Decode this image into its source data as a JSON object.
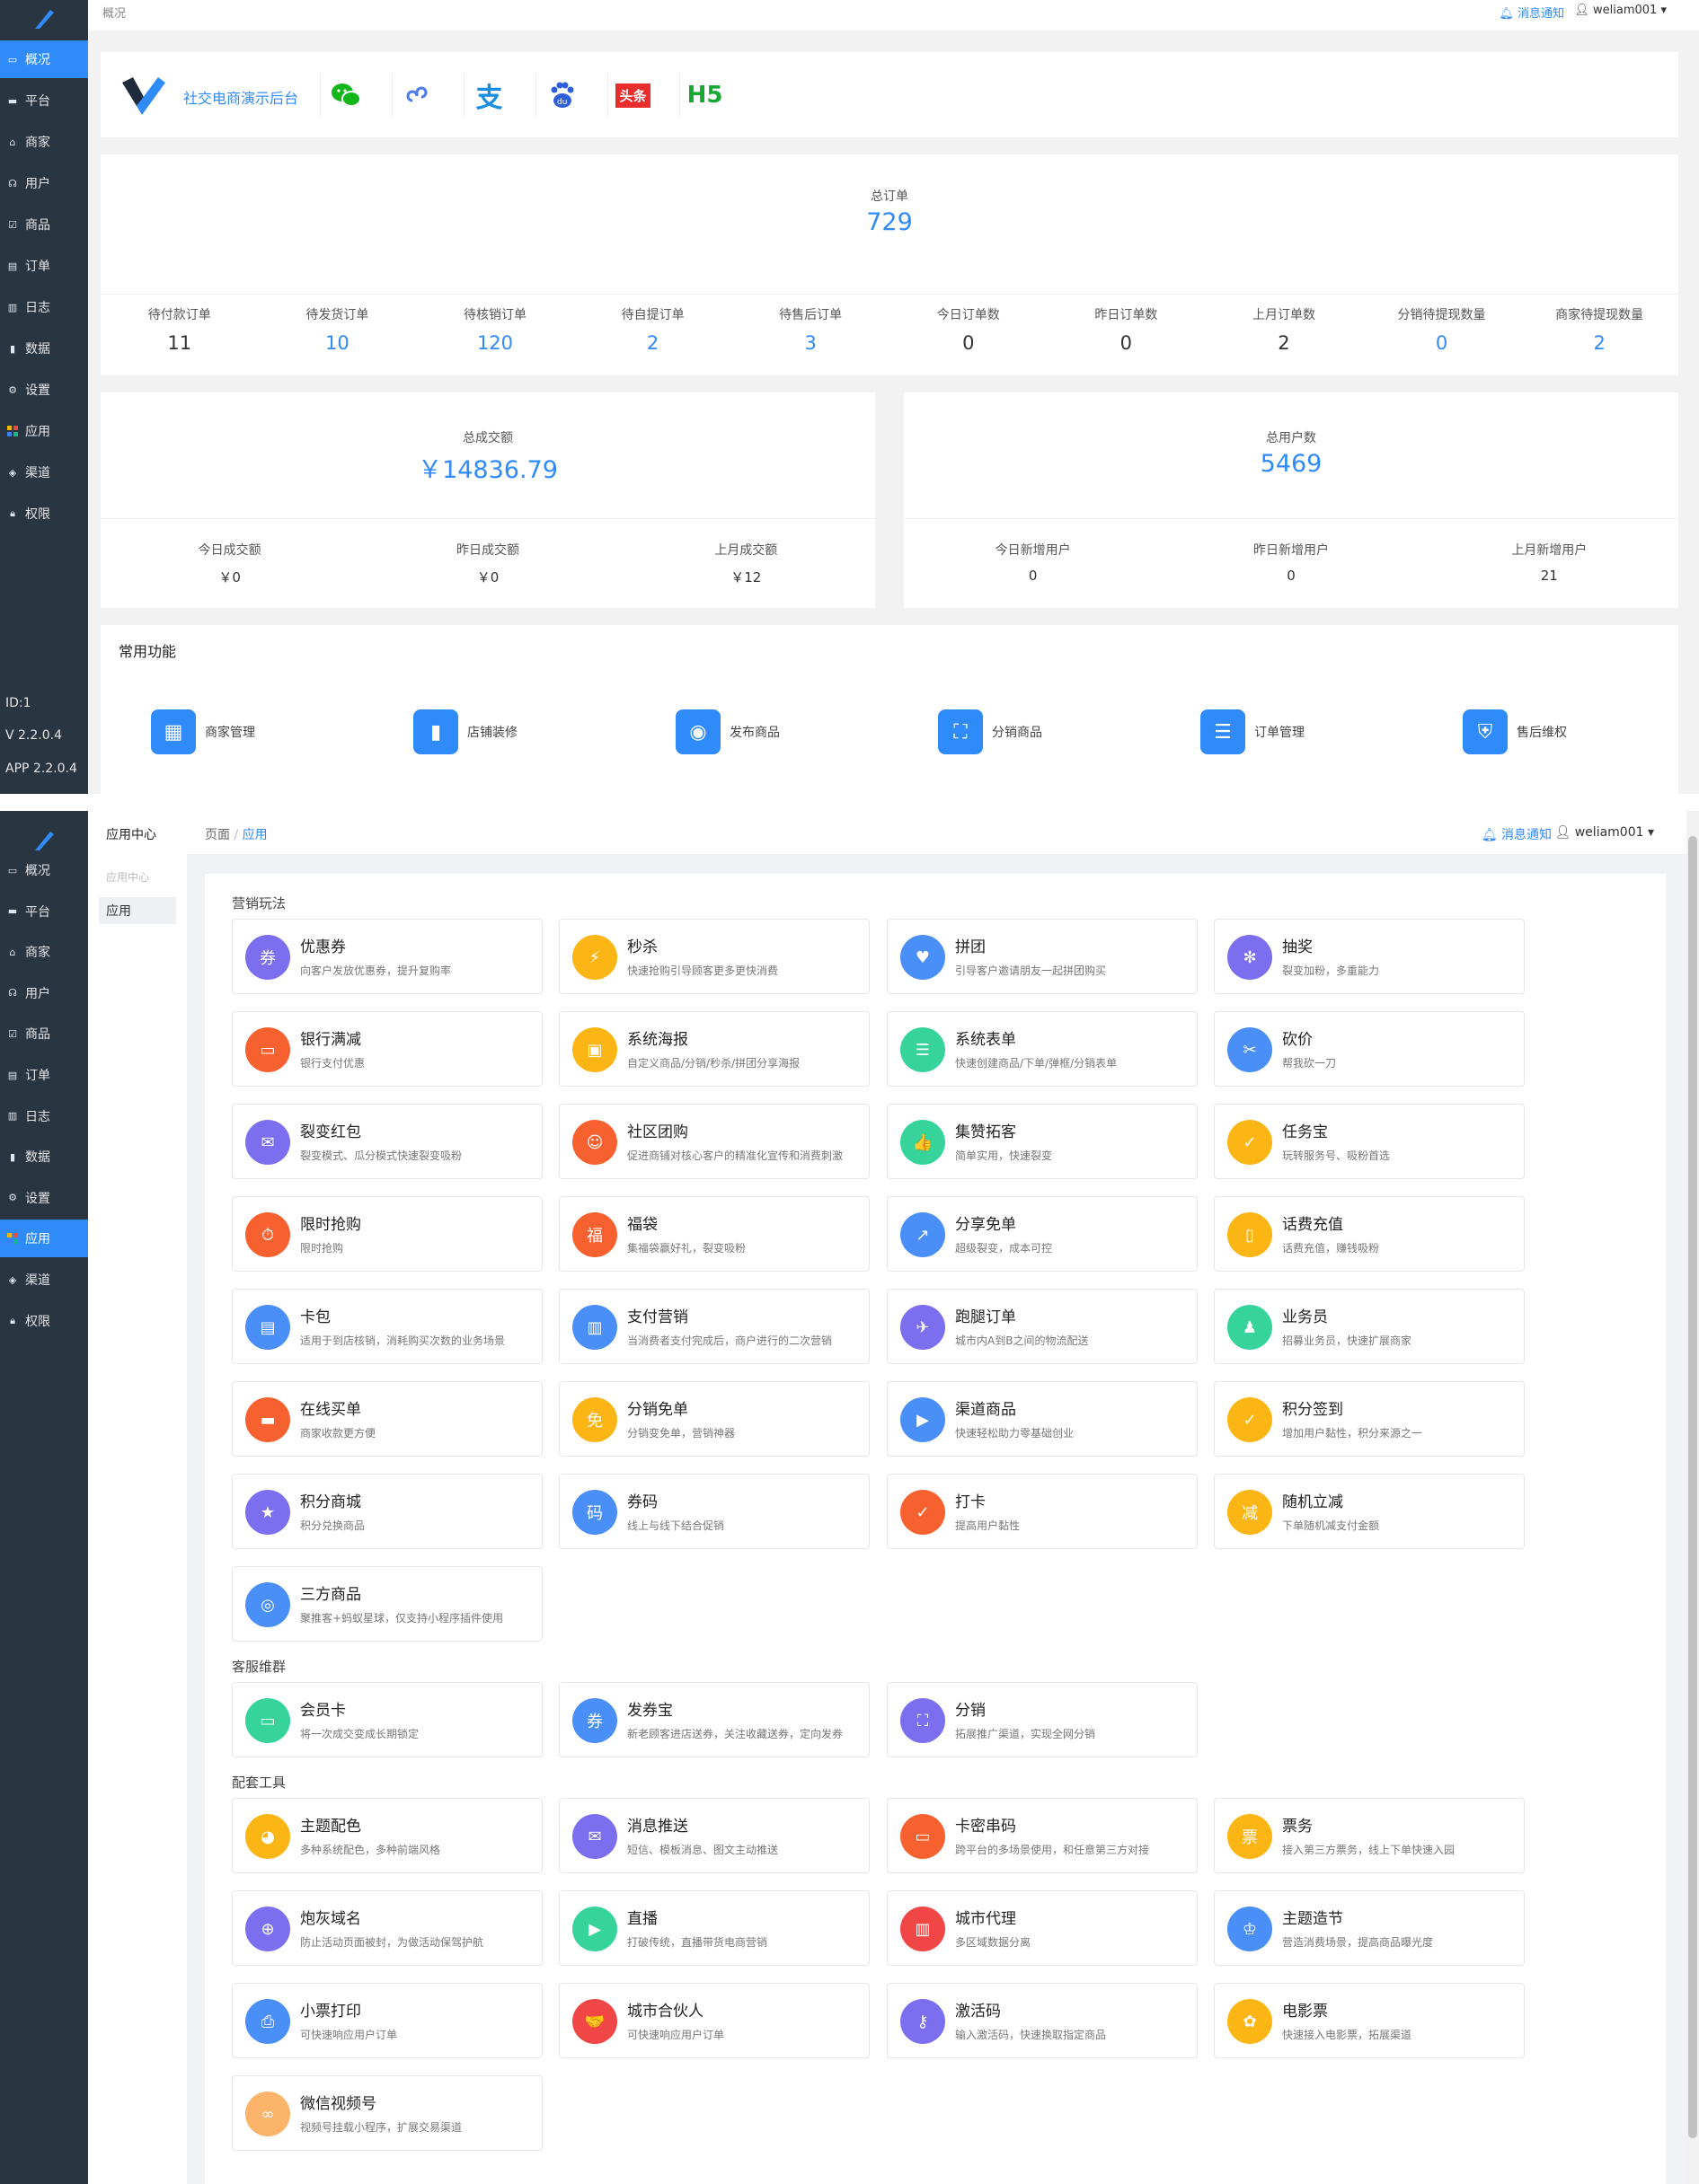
{
  "overview": {
    "breadcrumb": "概况",
    "notice": "消息通知",
    "user": "weliam001",
    "nav": [
      {
        "label": "概况",
        "icon": "monitor-icon"
      },
      {
        "label": "平台",
        "icon": "platform-icon"
      },
      {
        "label": "商家",
        "icon": "store-icon"
      },
      {
        "label": "用户",
        "icon": "headset-icon"
      },
      {
        "label": "商品",
        "icon": "goods-icon"
      },
      {
        "label": "订单",
        "icon": "order-icon"
      },
      {
        "label": "日志",
        "icon": "log-icon"
      },
      {
        "label": "数据",
        "icon": "chart-icon"
      },
      {
        "label": "设置",
        "icon": "gear-icon"
      },
      {
        "label": "应用",
        "icon": "apps-icon"
      },
      {
        "label": "渠道",
        "icon": "channel-icon"
      },
      {
        "label": "权限",
        "icon": "lock-icon"
      }
    ],
    "footer": {
      "id": "ID:1",
      "version": "V 2.2.0.4",
      "app_version": "APP 2.2.0.4"
    },
    "brand": {
      "name": "社交电商演示后台",
      "platforms": [
        "wechat-icon",
        "mini-program-icon",
        "alipay-icon",
        "baidu-icon",
        "toutiao-icon",
        "H5"
      ],
      "toutiao_label": "头条",
      "h5_label": "H5"
    },
    "orders": {
      "total_label": "总订单",
      "total": "729",
      "items": [
        {
          "label": "待付款订单",
          "value": "11",
          "color": "#333"
        },
        {
          "label": "待发货订单",
          "value": "10",
          "color": "#2f8bfa"
        },
        {
          "label": "待核销订单",
          "value": "120",
          "color": "#2f8bfa"
        },
        {
          "label": "待自提订单",
          "value": "2",
          "color": "#2f8bfa"
        },
        {
          "label": "待售后订单",
          "value": "3",
          "color": "#2f8bfa"
        },
        {
          "label": "今日订单数",
          "value": "0",
          "color": "#333"
        },
        {
          "label": "昨日订单数",
          "value": "0",
          "color": "#333"
        },
        {
          "label": "上月订单数",
          "value": "2",
          "color": "#333"
        },
        {
          "label": "分销待提现数量",
          "value": "0",
          "color": "#2f8bfa"
        },
        {
          "label": "商家待提现数量",
          "value": "2",
          "color": "#2f8bfa"
        }
      ]
    },
    "sales": {
      "label": "总成交额",
      "value": "￥14836.79",
      "items": [
        {
          "label": "今日成交额",
          "value": "￥0"
        },
        {
          "label": "昨日成交额",
          "value": "￥0"
        },
        {
          "label": "上月成交额",
          "value": "￥12"
        }
      ]
    },
    "users": {
      "label": "总用户数",
      "value": "5469",
      "items": [
        {
          "label": "今日新增用户",
          "value": "0"
        },
        {
          "label": "昨日新增用户",
          "value": "0"
        },
        {
          "label": "上月新增用户",
          "value": "21"
        }
      ]
    },
    "common": {
      "title": "常用功能",
      "items": [
        "商家管理",
        "店铺装修",
        "发布商品",
        "分销商品",
        "订单管理",
        "售后维权"
      ]
    }
  },
  "apps_page": {
    "sub_title": "应用中心",
    "sub_group": "应用中心",
    "sub_item": "应用",
    "breadcrumb": [
      "页面",
      "应用"
    ],
    "breadcrumb_sep": "/",
    "notice": "消息通知",
    "user": "weliam001",
    "sections": [
      {
        "title": "营销玩法",
        "apps": [
          {
            "name": "优惠券",
            "desc": "向客户发放优惠券，提升复购率",
            "color": "#7b6ff0",
            "glyph": "券"
          },
          {
            "name": "秒杀",
            "desc": "快速抢购引导顾客更多更快消费",
            "color": "#fbb615",
            "glyph": "⚡"
          },
          {
            "name": "拼团",
            "desc": "引导客户邀请朋友一起拼团购买",
            "color": "#4a8ff7",
            "glyph": "♥"
          },
          {
            "name": "抽奖",
            "desc": "裂变加粉，多重能力",
            "color": "#7b6ff0",
            "glyph": "✻"
          },
          {
            "name": "银行满减",
            "desc": "银行支付优惠",
            "color": "#f7612f",
            "glyph": "▭"
          },
          {
            "name": "系统海报",
            "desc": "自定义商品/分销/秒杀/拼团分享海报",
            "color": "#fbb615",
            "glyph": "▣"
          },
          {
            "name": "系统表单",
            "desc": "快速创建商品/下单/弹框/分销表单",
            "color": "#36d49b",
            "glyph": "☰"
          },
          {
            "name": "砍价",
            "desc": "帮我砍一刀",
            "color": "#4a8ff7",
            "glyph": "✂"
          },
          {
            "name": "裂变红包",
            "desc": "裂变模式、瓜分模式快速裂变吸粉",
            "color": "#7b6ff0",
            "glyph": "✉"
          },
          {
            "name": "社区团购",
            "desc": "促进商铺对核心客户的精准化宣传和消费刺激",
            "color": "#f7612f",
            "glyph": "☺"
          },
          {
            "name": "集赞拓客",
            "desc": "简单实用，快速裂变",
            "color": "#36d49b",
            "glyph": "👍"
          },
          {
            "name": "任务宝",
            "desc": "玩转服务号、吸粉首选",
            "color": "#fbb615",
            "glyph": "✓"
          },
          {
            "name": "限时抢购",
            "desc": "限时抢购",
            "color": "#f7612f",
            "glyph": "⏱"
          },
          {
            "name": "福袋",
            "desc": "集福袋赢好礼，裂变吸粉",
            "color": "#f7612f",
            "glyph": "福"
          },
          {
            "name": "分享免单",
            "desc": "超级裂变，成本可控",
            "color": "#4a8ff7",
            "glyph": "↗"
          },
          {
            "name": "话费充值",
            "desc": "话费充值，赚钱吸粉",
            "color": "#fbb615",
            "glyph": "▯"
          },
          {
            "name": "卡包",
            "desc": "适用于到店核销，消耗购买次数的业务场景",
            "color": "#4a8ff7",
            "glyph": "▤"
          },
          {
            "name": "支付营销",
            "desc": "当消费者支付完成后，商户进行的二次营销",
            "color": "#4a8ff7",
            "glyph": "▥"
          },
          {
            "name": "跑腿订单",
            "desc": "城市内A到B之间的物流配送",
            "color": "#7b6ff0",
            "glyph": "✈"
          },
          {
            "name": "业务员",
            "desc": "招募业务员，快速扩展商家",
            "color": "#36d49b",
            "glyph": "♟"
          },
          {
            "name": "在线买单",
            "desc": "商家收款更方便",
            "color": "#f7612f",
            "glyph": "▬"
          },
          {
            "name": "分销免单",
            "desc": "分销变免单，营销神器",
            "color": "#fbb615",
            "glyph": "免"
          },
          {
            "name": "渠道商品",
            "desc": "快速轻松助力零基础创业",
            "color": "#4a8ff7",
            "glyph": "▶"
          },
          {
            "name": "积分签到",
            "desc": "增加用户黏性，积分来源之一",
            "color": "#fbb615",
            "glyph": "✓"
          },
          {
            "name": "积分商城",
            "desc": "积分兑换商品",
            "color": "#7b6ff0",
            "glyph": "★"
          },
          {
            "name": "券码",
            "desc": "线上与线下结合促销",
            "color": "#4a8ff7",
            "glyph": "码"
          },
          {
            "name": "打卡",
            "desc": "提高用户黏性",
            "color": "#f7612f",
            "glyph": "✓"
          },
          {
            "name": "随机立减",
            "desc": "下单随机减支付金额",
            "color": "#fbb615",
            "glyph": "减"
          },
          {
            "name": "三方商品",
            "desc": "聚推客+蚂蚁星球，仅支持小程序插件使用",
            "color": "#4a8ff7",
            "glyph": "◎"
          }
        ]
      },
      {
        "title": "客服维群",
        "apps": [
          {
            "name": "会员卡",
            "desc": "将一次成交变成长期锁定",
            "color": "#36d49b",
            "glyph": "▭"
          },
          {
            "name": "发券宝",
            "desc": "新老顾客进店送券，关注收藏送券，定向发券",
            "color": "#4a8ff7",
            "glyph": "券"
          },
          {
            "name": "分销",
            "desc": "拓展推广渠道，实现全网分销",
            "color": "#7b6ff0",
            "glyph": "⛶"
          }
        ]
      },
      {
        "title": "配套工具",
        "apps": [
          {
            "name": "主题配色",
            "desc": "多种系统配色，多种前端风格",
            "color": "#fbb615",
            "glyph": "◕"
          },
          {
            "name": "消息推送",
            "desc": "短信、模板消息、图文主动推送",
            "color": "#7b6ff0",
            "glyph": "✉"
          },
          {
            "name": "卡密串码",
            "desc": "跨平台的多场景使用，和任意第三方对接",
            "color": "#f7612f",
            "glyph": "▭"
          },
          {
            "name": "票务",
            "desc": "接入第三方票务，线上下单快速入园",
            "color": "#fbb615",
            "glyph": "票"
          },
          {
            "name": "炮灰域名",
            "desc": "防止活动页面被封，为做活动保驾护航",
            "color": "#7b6ff0",
            "glyph": "⊕"
          },
          {
            "name": "直播",
            "desc": "打破传统，直播带货电商营销",
            "color": "#36d49b",
            "glyph": "▶"
          },
          {
            "name": "城市代理",
            "desc": "多区域数据分离",
            "color": "#f04646",
            "glyph": "▥"
          },
          {
            "name": "主题造节",
            "desc": "营造消费场景，提高商品曝光度",
            "color": "#4a8ff7",
            "glyph": "♔"
          },
          {
            "name": "小票打印",
            "desc": "可快速响应用户订单",
            "color": "#4a8ff7",
            "glyph": "⎙"
          },
          {
            "name": "城市合伙人",
            "desc": "可快速响应用户订单",
            "color": "#f04646",
            "glyph": "🤝"
          },
          {
            "name": "激活码",
            "desc": "输入激活码，快速换取指定商品",
            "color": "#7b6ff0",
            "glyph": "⚷"
          },
          {
            "name": "电影票",
            "desc": "快速接入电影票，拓展渠道",
            "color": "#fbb615",
            "glyph": "✿"
          },
          {
            "name": "微信视频号",
            "desc": "视频号挂载小程序，扩展交易渠道",
            "color": "#fbb46a",
            "glyph": "∞"
          }
        ]
      }
    ]
  }
}
